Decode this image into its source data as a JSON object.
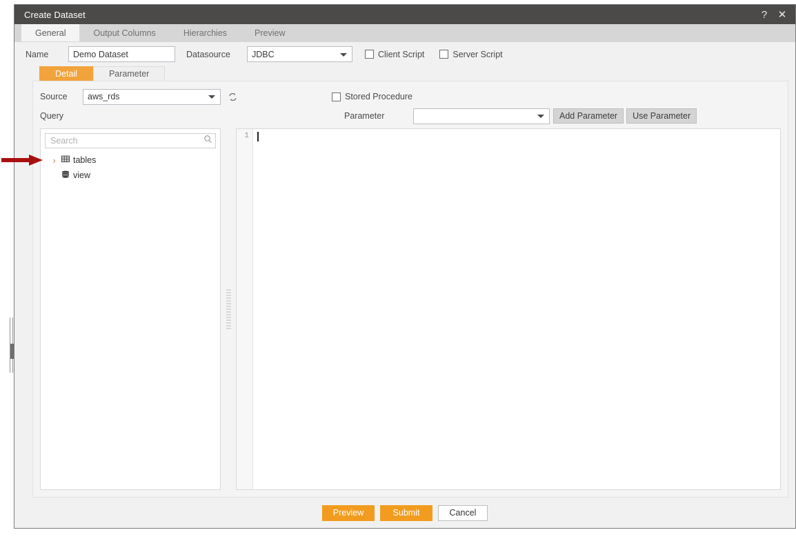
{
  "window": {
    "title": "Create Dataset",
    "help_icon": "?",
    "close_icon": "✕"
  },
  "tabs": [
    {
      "label": "General",
      "active": true
    },
    {
      "label": "Output Columns",
      "active": false
    },
    {
      "label": "Hierarchies",
      "active": false
    },
    {
      "label": "Preview",
      "active": false
    }
  ],
  "form": {
    "name_label": "Name",
    "name_value": "Demo Dataset",
    "datasource_label": "Datasource",
    "datasource_value": "JDBC",
    "client_script_label": "Client Script",
    "client_script_checked": false,
    "server_script_label": "Server Script",
    "server_script_checked": false
  },
  "subtabs": [
    {
      "label": "Detail",
      "active": true
    },
    {
      "label": "Parameter",
      "active": false
    }
  ],
  "detail": {
    "source_label": "Source",
    "source_value": "aws_rds",
    "refresh_icon": "refresh-icon",
    "query_label": "Query",
    "stored_procedure_label": "Stored Procedure",
    "stored_procedure_checked": false,
    "parameter_label": "Parameter",
    "parameter_value": "",
    "add_parameter_label": "Add Parameter",
    "use_parameter_label": "Use Parameter"
  },
  "tree": {
    "search_placeholder": "Search",
    "search_value": "",
    "nodes": [
      {
        "label": "tables",
        "icon": "grid-table-icon",
        "expandable": true,
        "expanded": false
      },
      {
        "label": "view",
        "icon": "database-stack-icon",
        "expandable": false,
        "expanded": false
      }
    ]
  },
  "editor": {
    "line_numbers": [
      "1"
    ],
    "content": ""
  },
  "footer": {
    "preview_label": "Preview",
    "submit_label": "Submit",
    "cancel_label": "Cancel"
  },
  "colors": {
    "titlebar": "#4c4a48",
    "accent": "#f29c1f",
    "subtab_active": "#f2a33c",
    "annotation_arrow": "#a81010"
  }
}
